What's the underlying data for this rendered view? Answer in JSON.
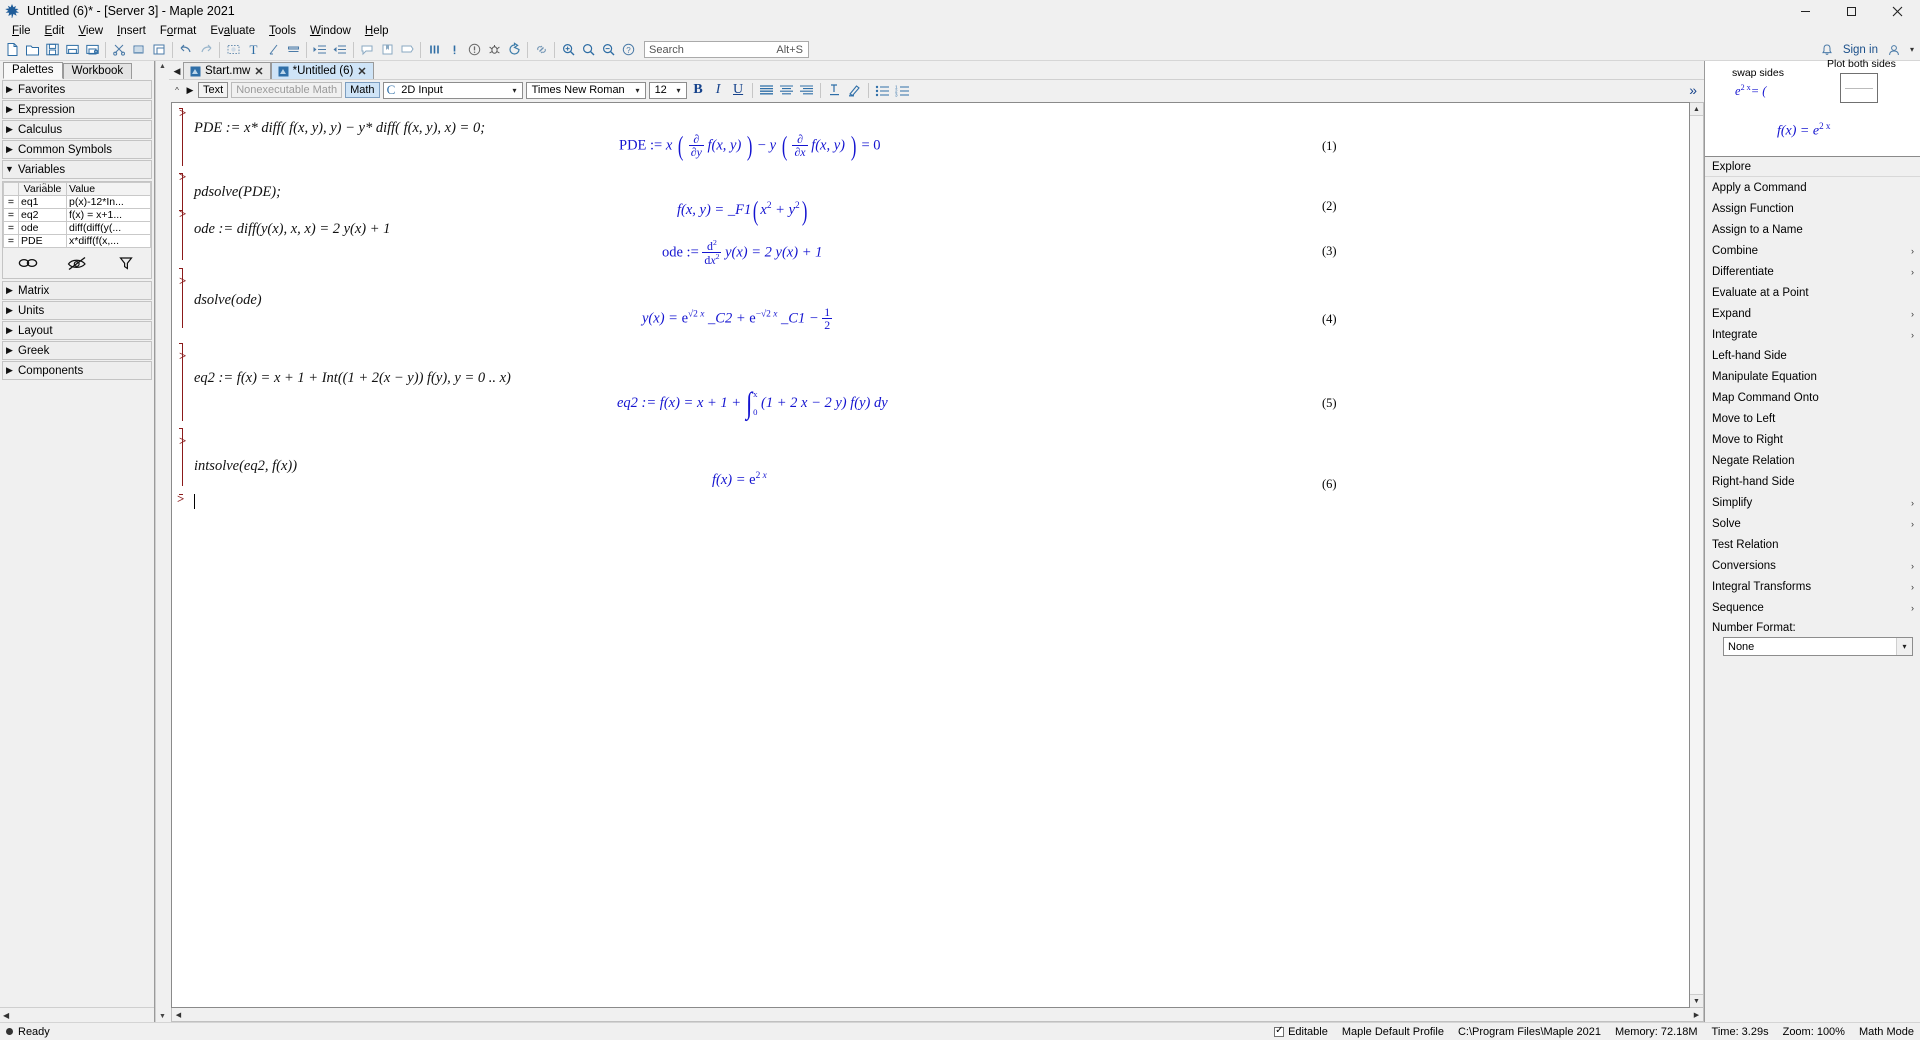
{
  "window": {
    "title": "Untitled (6)* - [Server 3] - Maple 2021",
    "app_icon": "maple-leaf-icon",
    "minimize": "–",
    "maximize": "□",
    "close": "✕"
  },
  "menubar": {
    "items": [
      {
        "label": "File",
        "mnemonic": "F"
      },
      {
        "label": "Edit",
        "mnemonic": "E"
      },
      {
        "label": "View",
        "mnemonic": "V"
      },
      {
        "label": "Insert",
        "mnemonic": "I"
      },
      {
        "label": "Format",
        "mnemonic": "o"
      },
      {
        "label": "Evaluate",
        "mnemonic": "a"
      },
      {
        "label": "Tools",
        "mnemonic": "T"
      },
      {
        "label": "Window",
        "mnemonic": "W"
      },
      {
        "label": "Help",
        "mnemonic": "H"
      }
    ]
  },
  "toolbar": {
    "buttons": [
      "new-document-icon",
      "open-folder-icon",
      "save-icon",
      "save-as-icon",
      "print-icon",
      "cut-scissors-icon",
      "copy-icon",
      "paste-icon",
      "undo-arrow-icon",
      "redo-arrow-icon",
      "text-region-icon",
      "text-cursor-icon",
      "math-input-icon",
      "hyperlink-block-icon",
      "indent-icon",
      "outdent-icon",
      "callout-icon",
      "bookmark-icon",
      "annotate-icon",
      "execute-all-icon",
      "execute-icon",
      "interrupt-icon",
      "debug-icon",
      "restart-kernel-icon",
      "link-icon",
      "zoom-in-icon",
      "zoom-out-icon",
      "zoom-reset-icon",
      "help-icon"
    ],
    "search": {
      "placeholder": "Search",
      "shortcut": "Alt+S"
    },
    "notifications_icon": "bell-icon",
    "signin_label": "Sign in",
    "account_icon": "user-icon",
    "account_caret": "▾"
  },
  "left_panel": {
    "tabs": [
      {
        "label": "Palettes",
        "active": true
      },
      {
        "label": "Workbook",
        "active": false
      }
    ],
    "palettes": [
      {
        "label": "Favorites",
        "expanded": false
      },
      {
        "label": "Expression",
        "expanded": false
      },
      {
        "label": "Calculus",
        "expanded": false
      },
      {
        "label": "Common Symbols",
        "expanded": false
      },
      {
        "label": "Variables",
        "expanded": true
      }
    ],
    "palettes_after": [
      {
        "label": "Matrix",
        "expanded": false
      },
      {
        "label": "Units",
        "expanded": false
      },
      {
        "label": "Layout",
        "expanded": false
      },
      {
        "label": "Greek",
        "expanded": false
      },
      {
        "label": "Components",
        "expanded": false
      }
    ],
    "variables_table": {
      "headers": [
        "",
        "Variable",
        "Value"
      ],
      "sort_indicator": "^",
      "rows": [
        {
          "marker": "=",
          "variable": "eq1",
          "value": "p(x)-12*In..."
        },
        {
          "marker": "=",
          "variable": "eq2",
          "value": "f(x) = x+1..."
        },
        {
          "marker": "=",
          "variable": "ode",
          "value": "diff(diff(y(..."
        },
        {
          "marker": "=",
          "variable": "PDE",
          "value": "x*diff(f(x,..."
        }
      ]
    },
    "variables_actions": [
      "link-variables-icon",
      "hide-variables-icon",
      "filter-icon"
    ],
    "scroll_up": "▲",
    "scroll_down": "▼",
    "collapse_arrow": "◀"
  },
  "document_tabs": {
    "nav_arrow": "◀",
    "tabs": [
      {
        "label": "Start.mw",
        "active": false,
        "close": "✕",
        "icon": "maple-doc-icon"
      },
      {
        "label": "*Untitled (6)",
        "active": true,
        "close": "✕",
        "icon": "maple-doc-icon"
      }
    ]
  },
  "format_toolbar": {
    "scroll_up": "^",
    "nav_arrow": "▶",
    "text_button": "Text",
    "nonexec_button": "Nonexecutable Math",
    "math_button": "Math",
    "mode_combo": {
      "value": "2D Input",
      "caret": "▾",
      "icon": "maple-c-icon"
    },
    "font_combo": {
      "value": "Times New Roman",
      "caret": "▾"
    },
    "size_combo": {
      "value": "12",
      "caret": "▾"
    },
    "bold": "B",
    "italic": "I",
    "underline": "U",
    "align_buttons": [
      "align-left-icon",
      "align-center-icon",
      "align-right-icon"
    ],
    "other_buttons": [
      "subscript-icon",
      "highlight-pen-icon",
      "bullet-list-icon",
      "numbered-list-icon"
    ],
    "expand_chevron": "»"
  },
  "worksheet": {
    "groups": [
      {
        "prompt": ">",
        "input": "PDE := x* diff( f(x, y), y) − y* diff( f(x, y), x) = 0;",
        "output_label": "(1)",
        "output_kind": "pde-assignment"
      },
      {
        "prompt": ">",
        "input": "pdsolve(PDE);",
        "output_label": "(2)",
        "output_kind": "general-solution"
      },
      {
        "prompt": ">",
        "input": "ode := diff(y(x), x, x) = 2 y(x) + 1",
        "output_label": "(3)",
        "output_kind": "ode-assignment"
      },
      {
        "prompt": ">",
        "input": "dsolve(ode)",
        "output_label": "(4)",
        "output_kind": "ode-solution"
      },
      {
        "prompt": ">",
        "input": "eq2 := f(x) = x + 1 + Int((1 + 2(x − y)) f(y), y = 0 .. x)",
        "output_label": "(5)",
        "output_kind": "integral-equation"
      },
      {
        "prompt": ">",
        "input": "intsolve(eq2, f(x))",
        "output_label": "(6)",
        "output_kind": "exp-solution"
      },
      {
        "prompt": ">",
        "input": "",
        "output_label": "",
        "output_kind": "cursor"
      }
    ],
    "math_text": {
      "pde_out_prefix": "PDE :=",
      "pde_out_x": "x",
      "partial": "∂",
      "d_dy_den": "∂y",
      "d_dx_den": "∂x",
      "f_xy": "f(x, y)",
      "minus": "−",
      "y_var": "y",
      "equals_zero": "= 0",
      "sol2": "f(x, y) = _F1(x² + y²)",
      "sol2_base": "f(x, y) = _F1",
      "sol2_arg": "x² + y²",
      "ode_out_prefix": "ode :=",
      "ode_num": "d²",
      "ode_den": "dx²",
      "ode_rhs": "y(x) = 2 y(x) + 1",
      "sol4_lhs": "y(x) =",
      "sol4_e1": "e",
      "sol4_e1_exp": "√2 x",
      "sol4_c2": "_C2 +",
      "sol4_e2": "e",
      "sol4_e2_exp": "−√2 x",
      "sol4_c1": "_C1 −",
      "sol4_half_num": "1",
      "sol4_half_den": "2",
      "eq5_prefix": "eq2 := f(x) = x + 1 +",
      "eq5_int_upper": "x",
      "eq5_int_lower": "0",
      "eq5_body": "(1 + 2 x − 2 y) f(y) dy",
      "sol6_lhs": "f(x) = ",
      "sol6_e": "e",
      "sol6_exp": "2 x"
    }
  },
  "right_panel": {
    "swap_sides_label": "swap sides",
    "plot_both_label": "Plot both sides",
    "preview_expr": "e",
    "preview_exp": "2 x",
    "preview_tail": "= (",
    "main_preview_lhs": "f(x) = e",
    "main_preview_exp": "2 x",
    "explore_label": "Explore",
    "items": [
      {
        "label": "Apply a Command",
        "has_submenu": false
      },
      {
        "label": "Assign Function",
        "has_submenu": false
      },
      {
        "label": "Assign to a Name",
        "has_submenu": false
      },
      {
        "label": "Combine",
        "has_submenu": true
      },
      {
        "label": "Differentiate",
        "has_submenu": true
      },
      {
        "label": "Evaluate at a Point",
        "has_submenu": false
      },
      {
        "label": "Expand",
        "has_submenu": false
      },
      {
        "label": "Integrate",
        "has_submenu": true
      },
      {
        "label": "Left-hand Side",
        "has_submenu": false
      },
      {
        "label": "Manipulate Equation",
        "has_submenu": false
      },
      {
        "label": "Map Command Onto",
        "has_submenu": false
      },
      {
        "label": "Move to Left",
        "has_submenu": false
      },
      {
        "label": "Move to Right",
        "has_submenu": false
      },
      {
        "label": "Negate Relation",
        "has_submenu": false
      },
      {
        "label": "Right-hand Side",
        "has_submenu": false
      },
      {
        "label": "Simplify",
        "has_submenu": true
      },
      {
        "label": "Solve",
        "has_submenu": true
      },
      {
        "label": "Test Relation",
        "has_submenu": false
      },
      {
        "label": "Conversions",
        "has_submenu": true
      },
      {
        "label": "Integral Transforms",
        "has_submenu": true
      },
      {
        "label": "Sequence",
        "has_submenu": true
      }
    ],
    "number_format_label": "Number Format:",
    "number_format_value": "None",
    "number_format_caret": "▾",
    "collapse_arrow": "▸"
  },
  "statusbar": {
    "status_label": "Ready",
    "editable_label": "Editable",
    "profile_label": "Maple Default Profile",
    "path_label": "C:\\Program Files\\Maple 2021",
    "memory_label": "Memory: 72.18M",
    "time_label": "Time: 3.29s",
    "zoom_label": "Zoom: 100%",
    "mode_label": "Math Mode"
  },
  "colors": {
    "output_blue": "#1414d0",
    "prompt_red": "#8b1a1a",
    "tab_active": "#cfe4f7",
    "icon_blue": "#15428b",
    "chrome": "#f0f0f0"
  }
}
